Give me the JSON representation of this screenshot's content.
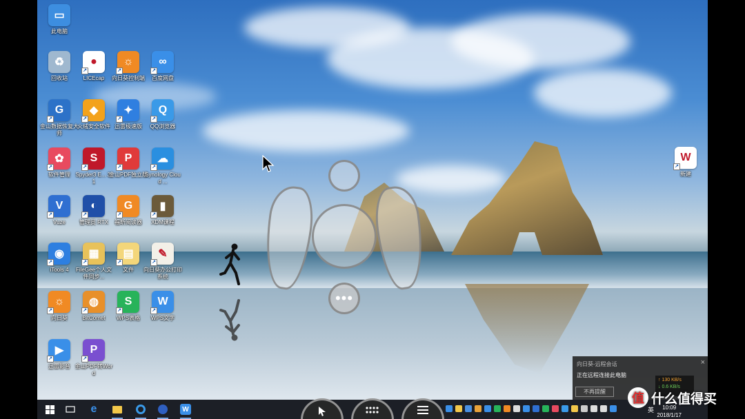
{
  "desktop_icons": [
    {
      "label": "此电脑",
      "color": "#3d8ee0",
      "glyph": "▭"
    },
    {
      "label": "回收站",
      "color": "#9fb8cf",
      "glyph": "♻"
    },
    {
      "label": "LICEcap",
      "color": "#ffffff",
      "glyph": "●"
    },
    {
      "label": "向日葵控制端",
      "color": "#f08a24",
      "glyph": "☼"
    },
    {
      "label": "百度网盘",
      "color": "#3a8fe8",
      "glyph": "∞"
    },
    {
      "label": "金山数据恢复大师",
      "color": "#2c72c8",
      "glyph": "G"
    },
    {
      "label": "火绒安全软件",
      "color": "#f3a21b",
      "glyph": "◆"
    },
    {
      "label": "迅雷极速版",
      "color": "#2f7fe0",
      "glyph": "✦"
    },
    {
      "label": "QQ浏览器",
      "color": "#3a9ae8",
      "glyph": "Q"
    },
    {
      "label": "软件管理",
      "color": "#e84a5f",
      "glyph": "✿"
    },
    {
      "label": "Spyder3 E... 3.1",
      "color": "#c0182a",
      "glyph": "S"
    },
    {
      "label": "金山PDF独立版",
      "color": "#e03a3a",
      "glyph": "P"
    },
    {
      "label": "Synology Cloud ...",
      "color": "#2a8fe0",
      "glyph": "☁"
    },
    {
      "label": "Vuze",
      "color": "#2f6fd1",
      "glyph": "V"
    },
    {
      "label": "管理员 RTX",
      "color": "#1f4fa8",
      "glyph": "◐"
    },
    {
      "label": "福昕阅读器",
      "color": "#f08a24",
      "glyph": "G"
    },
    {
      "label": "XDM课程",
      "color": "#6b5a3a",
      "glyph": "▮"
    },
    {
      "label": "iTools 4",
      "color": "#2d7fe0",
      "glyph": "◉"
    },
    {
      "label": "FileGee个人文件同步...",
      "color": "#e8c25a",
      "glyph": "▦"
    },
    {
      "label": "文件",
      "color": "#f3d67a",
      "glyph": "▤"
    },
    {
      "label": "向日葵办公打印系统",
      "color": "#f3f0e8",
      "glyph": "✎"
    },
    {
      "label": "向日葵",
      "color": "#f08a24",
      "glyph": "☼"
    },
    {
      "label": "BitComet",
      "color": "#e8902a",
      "glyph": "◍"
    },
    {
      "label": "WPS表格",
      "color": "#27b35a",
      "glyph": "S"
    },
    {
      "label": "WPS文字",
      "color": "#3a8fe8",
      "glyph": "W"
    },
    {
      "label": "迅雷影音",
      "color": "#3a8fe8",
      "glyph": "▶"
    },
    {
      "label": "金山PDF转Word",
      "color": "#7a4fd0",
      "glyph": "P"
    },
    {
      "label": "新建",
      "color": "#ffffff",
      "glyph": "W"
    }
  ],
  "overlay": {
    "more_glyph": "•••"
  },
  "popup": {
    "title": "向日葵-远程会话",
    "message": "正在远程连接此电脑",
    "button": "不再提醒",
    "close": "×"
  },
  "speed": {
    "up": "↑ 130 KB/s",
    "down": "↓ 0.6 KB/s"
  },
  "taskbar": {
    "ime": "英",
    "time": "10:09",
    "date": "2018/1/17"
  },
  "watermark": {
    "logo": "值",
    "text": "什么值得买"
  }
}
